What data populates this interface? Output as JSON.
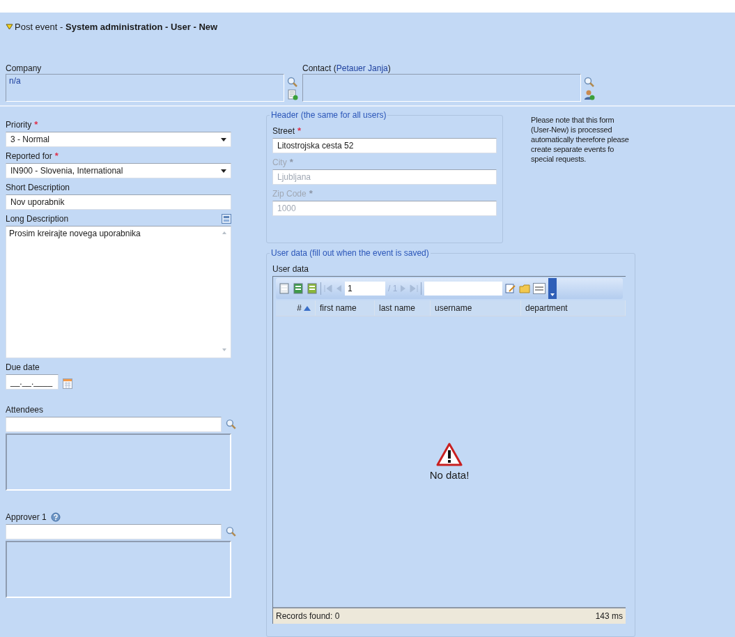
{
  "title": {
    "expanded": true,
    "prefix": "Post event",
    "separator": " - ",
    "parts": [
      "System administration",
      "User",
      "New"
    ]
  },
  "company": {
    "label": "Company",
    "value": "n/a"
  },
  "contact": {
    "label": "Contact",
    "open": "(",
    "name": "Petauer Janja",
    "close": ")"
  },
  "left_fields": [
    {
      "kind": "select",
      "label": "Priority",
      "required_mark": "*",
      "value": "3 - Normal"
    },
    {
      "kind": "select",
      "label": "Reported for",
      "required_mark": "*",
      "value": "IN900 - Slovenia, International"
    },
    {
      "kind": "text",
      "label": "Short Description",
      "value": "Nov uporabnik"
    },
    {
      "kind": "textarea",
      "label": "Long Description",
      "value": "Prosim kreirajte novega uporabnika"
    },
    {
      "kind": "date",
      "label": "Due date",
      "value": "__.__.____"
    },
    {
      "kind": "lookup",
      "label": "Attendees",
      "help": false
    },
    {
      "kind": "lookup",
      "label": "Approver 1",
      "help": true
    }
  ],
  "header_group": {
    "legend": "Header (the same for all users)",
    "fields": [
      {
        "label": "Street",
        "required_mark": "*",
        "disabled": false,
        "value": "Litostrojska cesta 52"
      },
      {
        "label": "City",
        "required_mark": "*",
        "disabled": true,
        "value": "Ljubljana"
      },
      {
        "label": "Zip Code",
        "required_mark": "*",
        "disabled": true,
        "value": "1000"
      }
    ]
  },
  "note": "Please note that this form (User-New) is processed automatically therefore please create separate events fo special requests.",
  "user_data": {
    "legend": "User data (fill out when the event is saved)",
    "label": "User data",
    "toolbar": {
      "page": "1",
      "page_total": "/ 1"
    },
    "columns": [
      {
        "label": "#",
        "sorted": true
      },
      {
        "label": "first name",
        "sorted": false
      },
      {
        "label": "last name",
        "sorted": false
      },
      {
        "label": "username",
        "sorted": false
      },
      {
        "label": "department",
        "sorted": false
      }
    ],
    "empty_message": "No data!",
    "records": "Records found: 0",
    "timing": "143 ms"
  }
}
